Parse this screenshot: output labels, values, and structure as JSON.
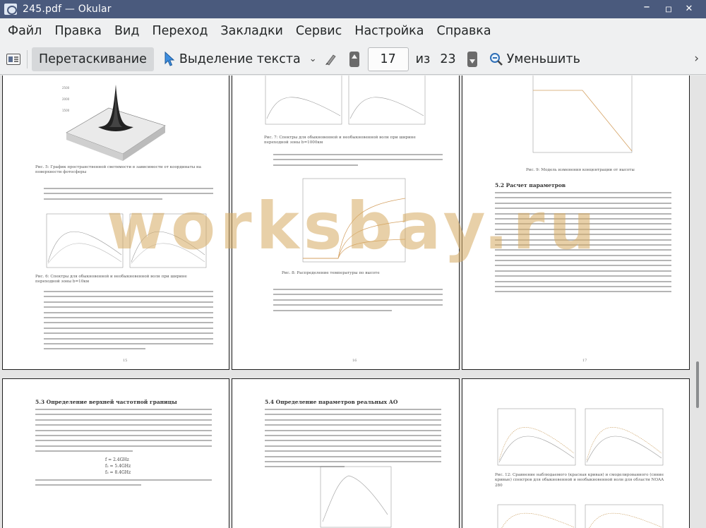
{
  "window": {
    "title": "245.pdf  — Okular",
    "controls": {
      "minimize": "–",
      "maximize": "◽",
      "close": "✕"
    }
  },
  "menu": [
    "Файл",
    "Правка",
    "Вид",
    "Переход",
    "Закладки",
    "Сервис",
    "Настройка",
    "Справка"
  ],
  "toolbar": {
    "drag_label": "Перетаскивание",
    "select_label": "Выделение текста",
    "current_page": "17",
    "of_label": "из",
    "total_pages": "23",
    "zoom_out_label": "Уменьшить"
  },
  "pages": {
    "a": {
      "caption1": "Рис. 5: График пространственной светимости в зависимости от координаты на поверхности фотосферы",
      "caption2": "Рис. 6: Спектры для обыкновенной и необыкновенной волн при ширине переходной зоны b=10км",
      "number": "15"
    },
    "b": {
      "caption1": "Рис. 7: Спектры для обыкновенной и необыкновенной волн при ширине переходной зоны b=1000км",
      "caption2": "Рис. 8: Распределение температуры по высоте",
      "number": "16"
    },
    "c": {
      "caption1": "Рис. 9: Модель изменения концентрации от высоты",
      "section": "5.2    Расчет параметров",
      "number": "17"
    },
    "d": {
      "section": "5.3    Определение верхней частотной границы",
      "equations": [
        "f = 2.4GHz",
        "f₂ = 5.4GHz",
        "f₃ = 8.4GHz"
      ]
    },
    "e": {
      "section": "5.4    Определение параметров реальных АО"
    },
    "f": {
      "caption1": "Рис. 12: Сравнение наблюдаемого (красная кривая) и смоделированного (синие кривые) спектров для обыкновенной и необыкновенной волн для области NOAA 280"
    }
  },
  "watermark": "worksbay.ru",
  "colors": {
    "titlebar": "#4a5a7d",
    "toolbar": "#eff0f1",
    "watermark": "#d6aa60"
  }
}
